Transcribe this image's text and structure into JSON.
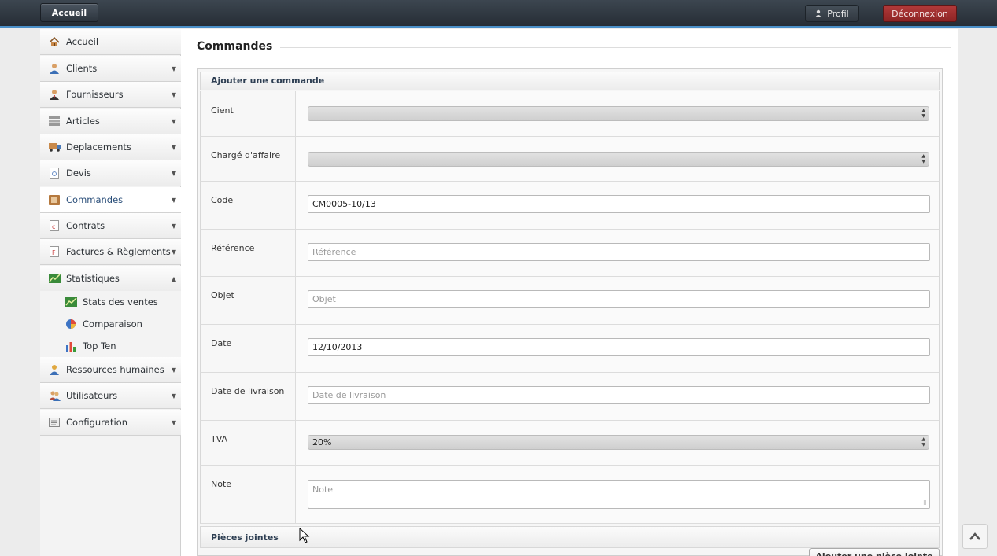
{
  "header": {
    "home_label": "Accueil",
    "profile_label": "Profil",
    "logout_label": "Déconnexion"
  },
  "sidebar": {
    "items": [
      {
        "label": "Accueil",
        "icon": "house-icon"
      },
      {
        "label": "Clients",
        "icon": "client-icon"
      },
      {
        "label": "Fournisseurs",
        "icon": "supplier-icon"
      },
      {
        "label": "Articles",
        "icon": "articles-icon"
      },
      {
        "label": "Deplacements",
        "icon": "truck-icon"
      },
      {
        "label": "Devis",
        "icon": "quote-icon"
      },
      {
        "label": "Commandes",
        "icon": "orders-icon"
      },
      {
        "label": "Contrats",
        "icon": "contract-icon"
      },
      {
        "label": "Factures & Règlements",
        "icon": "invoice-icon"
      },
      {
        "label": "Statistiques",
        "icon": "stats-icon"
      },
      {
        "label": "Ressources humaines",
        "icon": "hr-icon"
      },
      {
        "label": "Utilisateurs",
        "icon": "users-icon"
      },
      {
        "label": "Configuration",
        "icon": "config-icon"
      }
    ],
    "stats_sub": [
      {
        "label": "Stats des ventes",
        "icon": "sales-chart-icon"
      },
      {
        "label": "Comparaison",
        "icon": "pie-chart-icon"
      },
      {
        "label": "Top Ten",
        "icon": "bar-chart-icon"
      }
    ],
    "active": "Commandes"
  },
  "main": {
    "title": "Commandes",
    "form_title": "Ajouter une commande",
    "fields": {
      "client": {
        "label": "Cient",
        "value": ""
      },
      "manager": {
        "label": "Chargé d'affaire",
        "value": ""
      },
      "code": {
        "label": "Code",
        "value": "CM0005-10/13"
      },
      "reference": {
        "label": "Référence",
        "placeholder": "Référence"
      },
      "object": {
        "label": "Objet",
        "placeholder": "Objet"
      },
      "date": {
        "label": "Date",
        "value": "12/10/2013"
      },
      "delivery_date": {
        "label": "Date de livraison",
        "placeholder": "Date de livraison"
      },
      "tva": {
        "label": "TVA",
        "value": "20%"
      },
      "note": {
        "label": "Note",
        "placeholder": "Note"
      }
    },
    "attachments_title": "Pièces jointes",
    "add_attachment_label": "Ajouter une pièce jointe"
  },
  "colors": {
    "topbar": "#2f373f",
    "accent_blue": "#4a8fc7",
    "logout_red": "#a32f2f",
    "heading_blue": "#2d3e52"
  }
}
